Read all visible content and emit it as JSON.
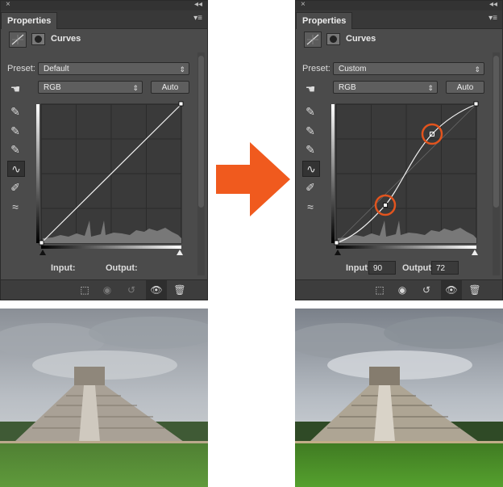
{
  "panels": [
    {
      "tab_label": "Properties",
      "close_glyph": "×",
      "collapse_glyph": "◂◂",
      "menu_glyph": "▾≡",
      "header_title": "Curves",
      "preset_label": "Preset:",
      "preset_value": "Default",
      "channel_value": "RGB",
      "auto_label": "Auto",
      "input_label": "Input:",
      "output_label": "Output:",
      "input_value": "",
      "output_value": ""
    },
    {
      "tab_label": "Properties",
      "close_glyph": "×",
      "collapse_glyph": "◂◂",
      "menu_glyph": "▾≡",
      "header_title": "Curves",
      "preset_label": "Preset:",
      "preset_value": "Custom",
      "channel_value": "RGB",
      "auto_label": "Auto",
      "input_label": "Input:",
      "output_label": "Output:",
      "input_value": "90",
      "output_value": "72"
    }
  ],
  "icons": {
    "hand_tool": "☚",
    "eyedropper": "✎",
    "curve_tool": "∿",
    "pencil": "✐",
    "smooth": "≈",
    "footer_clip": "⬚",
    "footer_view": "◉",
    "footer_reset": "↺",
    "footer_eye": "👁",
    "footer_trash": "🗑"
  },
  "colors": {
    "panel_bg": "#4b4b4b",
    "highlight_circle": "#e2541e",
    "arrow": "#f05a1e"
  }
}
